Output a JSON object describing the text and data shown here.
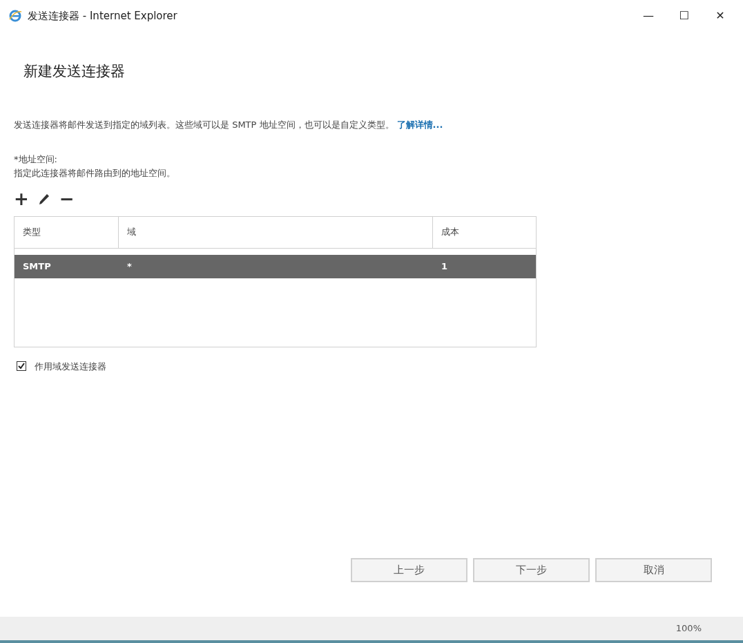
{
  "window": {
    "title": "发送连接器 - Internet Explorer",
    "controls": [
      "—",
      "☐",
      "✕"
    ]
  },
  "heading": "新建发送连接器",
  "description": "发送连接器将邮件发送到指定的域列表。这些域可以是 SMTP 地址空间，也可以是自定义类型。",
  "learn_more": "了解详情...",
  "address_space": {
    "label": "*地址空间:",
    "hint": "指定此连接器将邮件路由到的地址空间。"
  },
  "toolbar": [
    "+",
    "−"
  ],
  "table": {
    "columns": [
      "类型",
      "域",
      "成本"
    ],
    "rows": [
      {
        "cells": [
          "SMTP",
          "*",
          "1"
        ],
        "selected": true
      }
    ]
  },
  "scoped": {
    "label": "作用域发送连接器",
    "checked": true
  },
  "buttons": [
    "上一步",
    "下一步",
    "取消"
  ],
  "status_bar": {
    "zoom": "100%"
  }
}
